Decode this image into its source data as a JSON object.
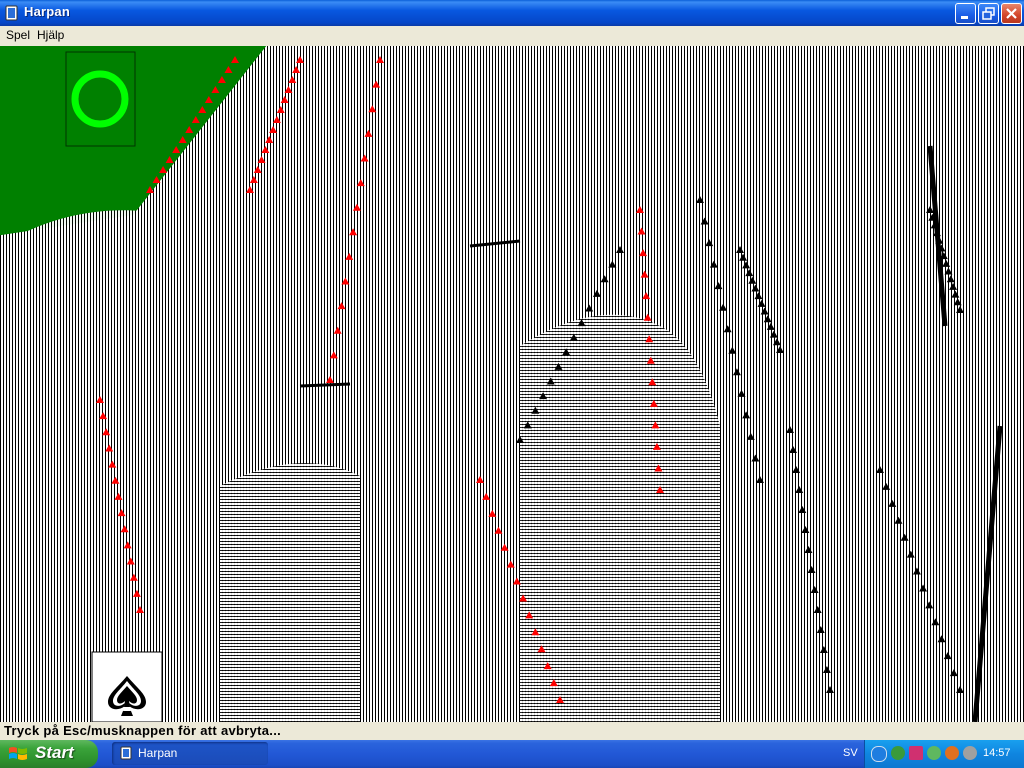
{
  "window": {
    "title": "Harpan"
  },
  "menu": {
    "items": [
      "Spel",
      "Hjälp"
    ]
  },
  "status": {
    "text": "Tryck på Esc/musknappen för att avbryta..."
  },
  "taskbar": {
    "start_label": "Start",
    "task_label": "Harpan",
    "language": "SV",
    "clock": "14:57"
  },
  "colors": {
    "felt": "#008000",
    "indicator": "#00ff00",
    "red_suit": "#ff0000"
  },
  "icons": [
    "app-icon",
    "minimize-icon",
    "maximize-icon",
    "close-icon",
    "windows-logo-icon",
    "spade-icon"
  ]
}
